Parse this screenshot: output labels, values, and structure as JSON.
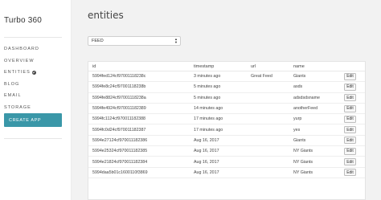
{
  "app": {
    "title": "Turbo 360"
  },
  "sidebar": {
    "items": [
      {
        "label": "DASHBOARD"
      },
      {
        "label": "OVERVIEW"
      },
      {
        "label": "ENTITIES"
      },
      {
        "label": "BLOG"
      },
      {
        "label": "EMAIL"
      },
      {
        "label": "STORAGE"
      }
    ],
    "create_app_label": "CREATE APP"
  },
  "main": {
    "title": "entities",
    "select": {
      "value": "FEED"
    },
    "table": {
      "headers": {
        "id": "id",
        "timestamp": "timestamp",
        "url": "url",
        "name": "name"
      },
      "edit_label": "Edit",
      "rows": [
        {
          "id": "5994fed124cf97001118238c",
          "timestamp": "3 minutes ago",
          "url": "Great Feed",
          "name": "Giants"
        },
        {
          "id": "5994fe8c24cf97001118238b",
          "timestamp": "5 minutes ago",
          "url": "",
          "name": "asds"
        },
        {
          "id": "5994fe8824cf97001118238a",
          "timestamp": "5 minutes ago",
          "url": "",
          "name": "adsdsdsname"
        },
        {
          "id": "5994fe4924cf970011182389",
          "timestamp": "14 minutes ago",
          "url": "",
          "name": "anotherFeed"
        },
        {
          "id": "5994fc1124cf970011182388",
          "timestamp": "17 minutes ago",
          "url": "",
          "name": "yurp"
        },
        {
          "id": "5994fc0d24cf970011182387",
          "timestamp": "17 minutes ago",
          "url": "",
          "name": "yes"
        },
        {
          "id": "5994e27124cf970011182386",
          "timestamp": "Aug 16, 2017",
          "url": "",
          "name": "Giants"
        },
        {
          "id": "5994e25324cf970011182385",
          "timestamp": "Aug 16, 2017",
          "url": "",
          "name": "NY Giants"
        },
        {
          "id": "5994e21824cf970011182384",
          "timestamp": "Aug 16, 2017",
          "url": "",
          "name": "NY Giants"
        },
        {
          "id": "5994daa5b01c1600110f3869",
          "timestamp": "Aug 16, 2017",
          "url": "",
          "name": "NY Giants"
        }
      ]
    }
  },
  "colors": {
    "accent": "#3a97a8",
    "main_bg": "#f2f2f2"
  }
}
